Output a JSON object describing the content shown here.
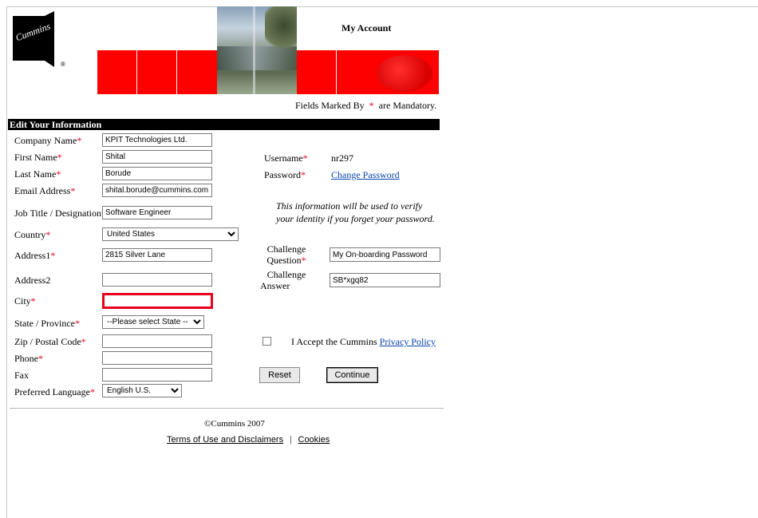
{
  "header": {
    "account_title": "My Account",
    "mandatory_prefix": "Fields Marked By",
    "mandatory_star": "*",
    "mandatory_suffix": "are Mandatory.",
    "logo_text": "Cummins",
    "logo_mark": "®",
    "brand_color": "#ff0000"
  },
  "section": {
    "title": "Edit Your Information"
  },
  "form": {
    "company_name": {
      "label": "Company Name",
      "value": "KPIT Technologies Ltd."
    },
    "first_name": {
      "label": "First Name",
      "value": "Shital"
    },
    "last_name": {
      "label": "Last Name",
      "value": "Borude"
    },
    "email": {
      "label": "Email Address",
      "value": "shital.borude@cummins.com"
    },
    "job_title": {
      "label": "Job Title / Designation",
      "value": "Software Engineer"
    },
    "country": {
      "label": "Country",
      "value": "United States"
    },
    "address1": {
      "label": "Address1",
      "value": "2815 Silver Lane"
    },
    "address2": {
      "label": "Address2",
      "value": ""
    },
    "city": {
      "label": "City",
      "value": ""
    },
    "state": {
      "label": "State / Province",
      "value": "--Please select State --"
    },
    "zip": {
      "label": "Zip / Postal Code",
      "value": ""
    },
    "phone": {
      "label": "Phone",
      "value": ""
    },
    "fax": {
      "label": "Fax",
      "value": ""
    },
    "language": {
      "label": "Preferred Language",
      "value": "English U.S."
    }
  },
  "account": {
    "username_label": "Username",
    "username_value": "nr297",
    "password_label": "Password",
    "change_password": "Change Password",
    "info_text": "This information will be used to verify your identity if you forget your password.",
    "challenge_question_label_1": "Challenge",
    "challenge_question_label_2": "Question",
    "challenge_question_value": "My On-boarding Password",
    "challenge_answer_label_1": "Challenge",
    "challenge_answer_label_2": "Answer",
    "challenge_answer_value": "SB*xgq82",
    "accept_text": "I Accept the Cummins",
    "privacy_link": "Privacy Policy",
    "reset": "Reset",
    "continue": "Continue"
  },
  "footer": {
    "copyright": "©Cummins 2007",
    "terms": "Terms of Use and Disclaimers",
    "separator": "|",
    "cookies": "Cookies"
  }
}
